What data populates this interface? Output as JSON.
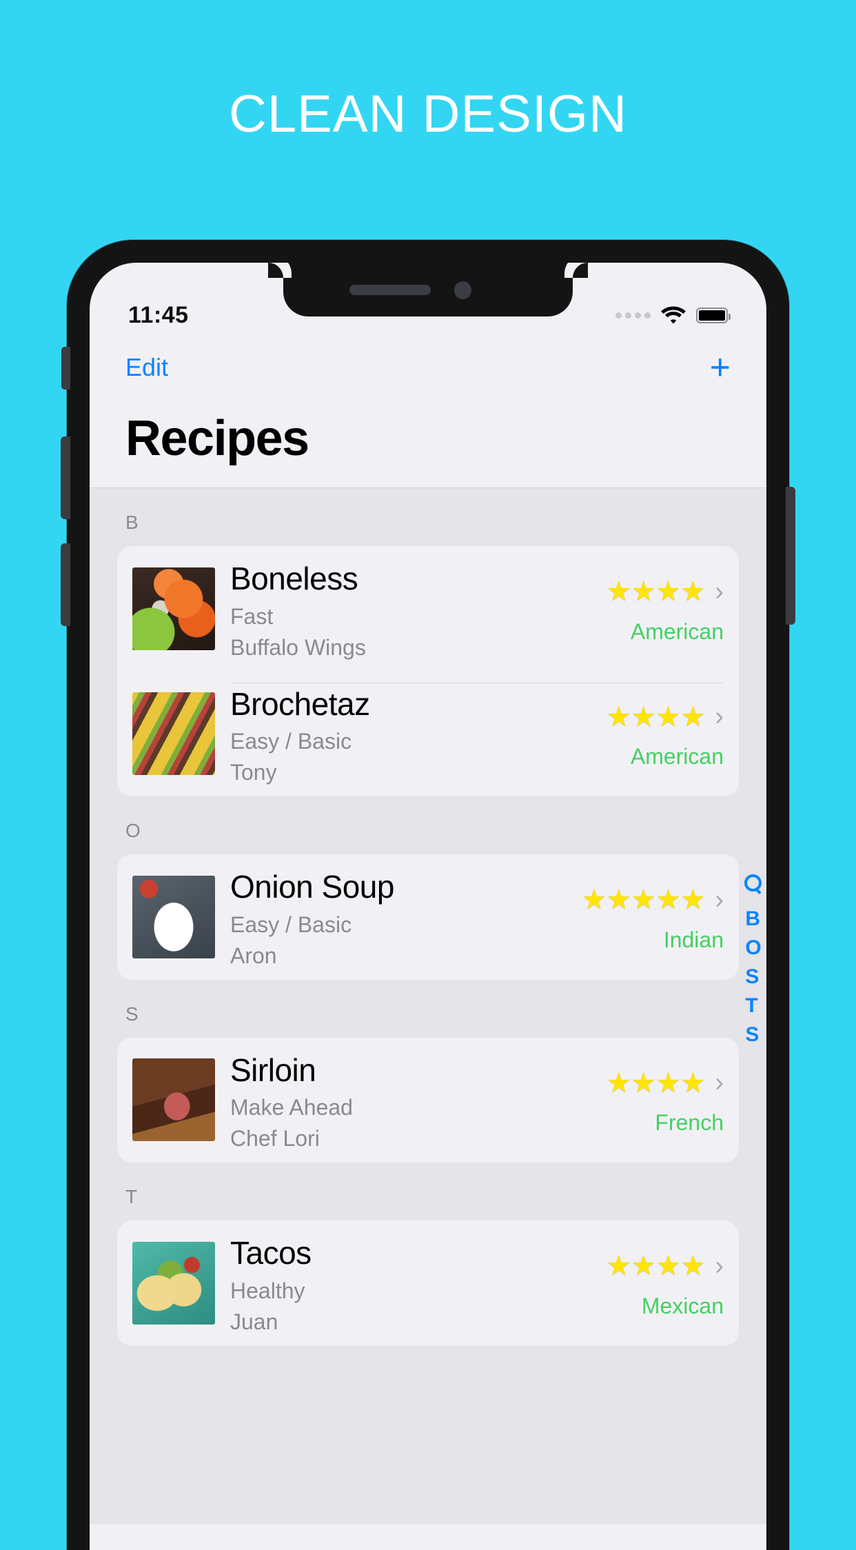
{
  "headline": "CLEAN DESIGN",
  "colors": {
    "background": "#33D6F2",
    "accent_blue": "#0A84FF",
    "cuisine_green": "#45D062",
    "star_yellow": "#FFE500",
    "list_background": "#E4E4E9",
    "card_background": "#F1F1F5"
  },
  "status_bar": {
    "time": "11:45",
    "signal_icon": "signal-dots-icon",
    "wifi_icon": "wifi-icon",
    "battery_icon": "battery-full-icon"
  },
  "nav": {
    "edit_label": "Edit",
    "add_label": "+",
    "title": "Recipes"
  },
  "sections": [
    {
      "letter": "B",
      "rows": [
        {
          "title": "Boneless",
          "subtitle": "Fast",
          "author": "Buffalo Wings",
          "rating": 4,
          "cuisine": "American",
          "thumb": "buffalo-wings-thumbnail",
          "chevron": "›"
        },
        {
          "title": "Brochetaz",
          "subtitle": "Easy / Basic",
          "author": "Tony",
          "rating": 4,
          "cuisine": "American",
          "thumb": "brochette-skewers-thumbnail",
          "chevron": "›"
        }
      ]
    },
    {
      "letter": "O",
      "rows": [
        {
          "title": "Onion Soup",
          "subtitle": "Easy / Basic",
          "author": "Aron",
          "rating": 5,
          "cuisine": "Indian",
          "thumb": "onion-soup-thumbnail",
          "chevron": "›"
        }
      ]
    },
    {
      "letter": "S",
      "rows": [
        {
          "title": "Sirloin",
          "subtitle": "Make Ahead",
          "author": "Chef Lori",
          "rating": 4,
          "cuisine": "French",
          "thumb": "sirloin-steak-thumbnail",
          "chevron": "›"
        }
      ]
    },
    {
      "letter": "T",
      "rows": [
        {
          "title": "Tacos",
          "subtitle": "Healthy",
          "author": "Juan",
          "rating": 4,
          "cuisine": "Mexican",
          "thumb": "tacos-thumbnail",
          "chevron": "›"
        }
      ]
    }
  ],
  "section_index": {
    "search_icon": "search-icon",
    "letters": [
      "B",
      "O",
      "S",
      "T",
      "S"
    ]
  }
}
